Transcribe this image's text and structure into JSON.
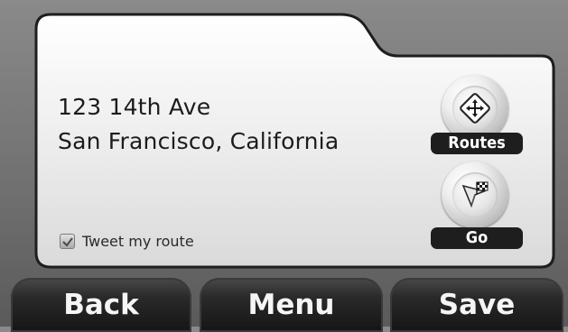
{
  "destination": {
    "address_line1": "123 14th Ave",
    "address_line2": "San Francisco, California"
  },
  "tweet_option": {
    "label": "Tweet my route",
    "checked": true
  },
  "actions": {
    "routes_label": "Routes",
    "routes_icon": "direction-arrows-icon",
    "go_label": "Go",
    "go_icon": "navigation-flag-icon"
  },
  "bottom_bar": {
    "back_label": "Back",
    "menu_label": "Menu",
    "save_label": "Save"
  },
  "colors": {
    "background": "#7a7a7a",
    "card": "#eeeeee",
    "pill": "#1e1e1e",
    "button": "#1f1f1f"
  }
}
